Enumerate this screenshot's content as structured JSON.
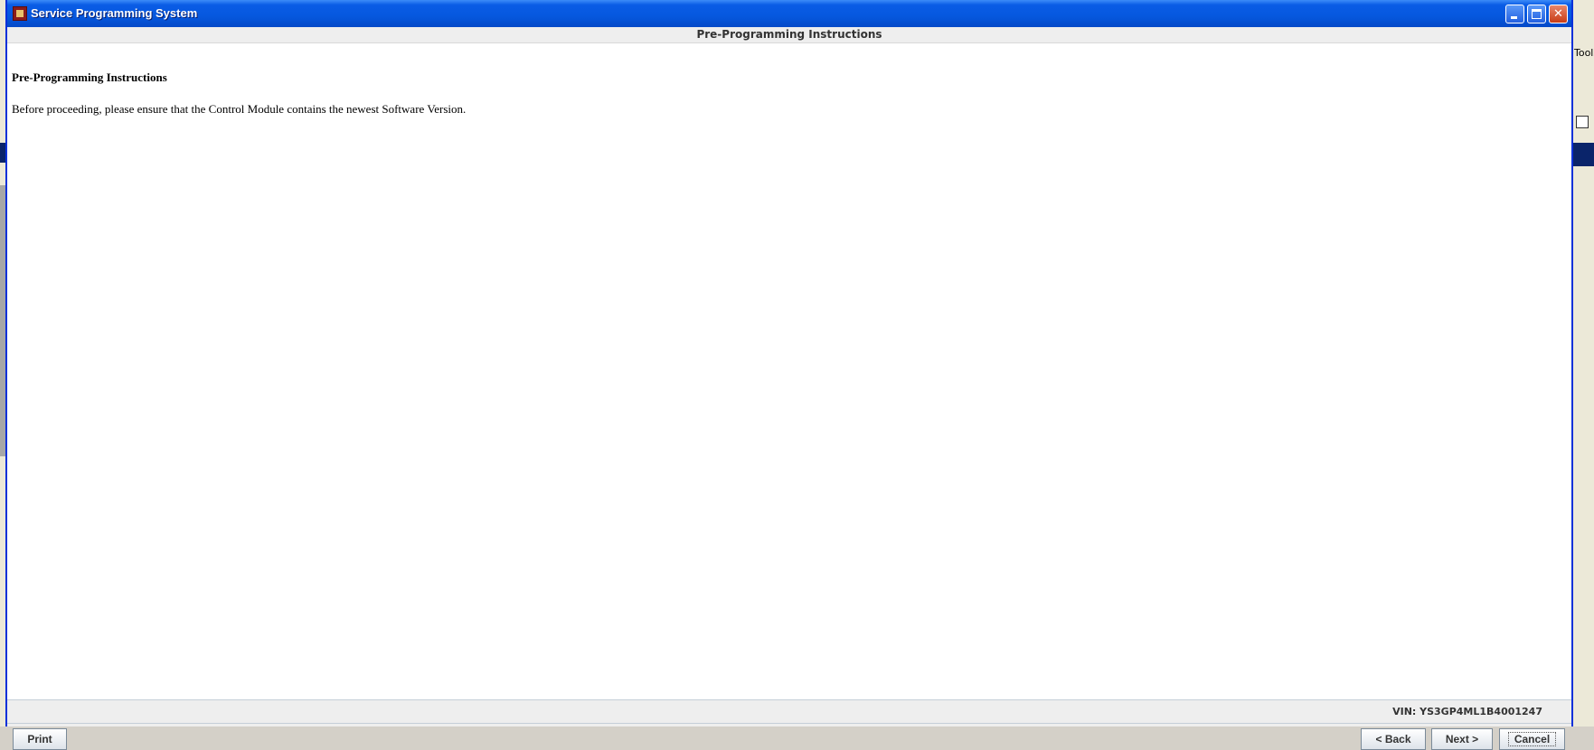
{
  "window": {
    "title": "Service Programming System"
  },
  "header": {
    "title": "Pre-Programming Instructions"
  },
  "content": {
    "heading": "Pre-Programming Instructions",
    "body": "Before proceeding, please ensure that the Control Module contains the newest Software Version."
  },
  "status": {
    "vin": "VIN: YS3GP4ML1B4001247"
  },
  "buttons": {
    "print": "Print",
    "back": "< Back",
    "next": "Next >",
    "cancel": "Cancel"
  },
  "background": {
    "tools_label": "Tools"
  },
  "icons": {
    "app": "service-programming-app-icon",
    "minimize": "minimize-icon",
    "maximize": "maximize-icon",
    "close": "close-icon"
  },
  "colors": {
    "titlebar": "#0a5ce6",
    "content_bg": "#ffffff",
    "panel_bg": "#eeeeee"
  }
}
